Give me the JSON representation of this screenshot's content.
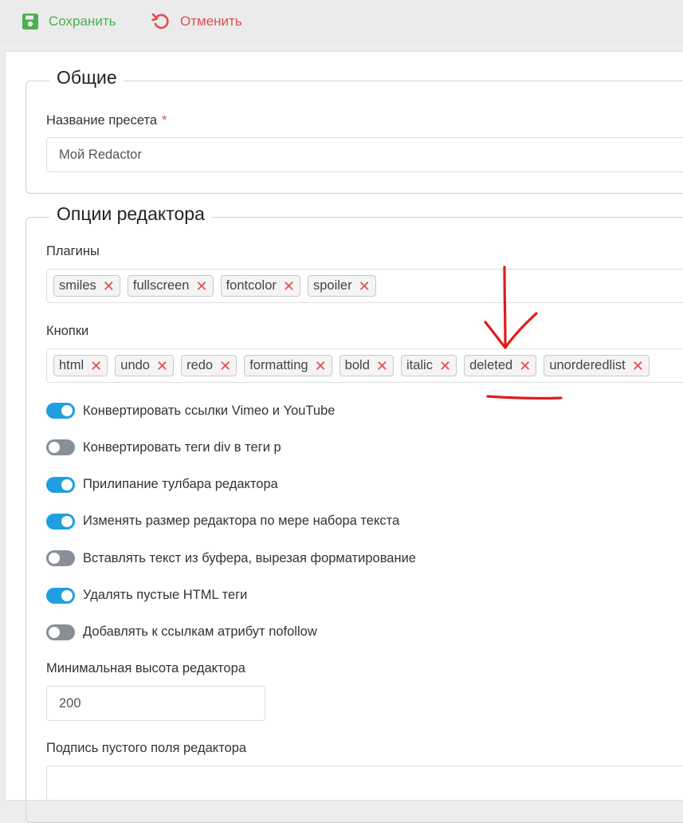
{
  "toolbar": {
    "save_label": "Сохранить",
    "cancel_label": "Отменить",
    "save_icon": "floppy-disk-icon",
    "cancel_icon": "undo-arrow-icon",
    "save_color": "#4caf50",
    "cancel_color": "#e34d4d"
  },
  "general": {
    "legend": "Общие",
    "preset_label": "Название пресета",
    "required_mark": "*",
    "preset_value": "Мой Redactor"
  },
  "editor": {
    "legend": "Опции редактора",
    "plugins_label": "Плагины",
    "plugins": [
      "smiles",
      "fullscreen",
      "fontcolor",
      "spoiler"
    ],
    "buttons_label": "Кнопки",
    "buttons": [
      "html",
      "undo",
      "redo",
      "formatting",
      "bold",
      "italic",
      "deleted",
      "unorderedlist"
    ],
    "remove_glyph": "✕",
    "toggles": [
      {
        "label": "Конвертировать ссылки Vimeo и YouTube",
        "on": true
      },
      {
        "label": "Конвертировать теги div в теги p",
        "on": false
      },
      {
        "label": "Прилипание тулбара редактора",
        "on": true
      },
      {
        "label": "Изменять размер редактора по мере набора текста",
        "on": true
      },
      {
        "label": "Вставлять текст из буфера, вырезая форматирование",
        "on": false
      },
      {
        "label": "Удалять пустые HTML теги",
        "on": true
      },
      {
        "label": "Добавлять к ссылкам атрибут nofollow",
        "on": false
      }
    ],
    "min_height_label": "Минимальная высота редактора",
    "min_height_value": "200",
    "placeholder_label": "Подпись пустого поля редактора",
    "placeholder_value": ""
  },
  "colors": {
    "toggle_on": "#1f9fe0",
    "toggle_off": "#888f96",
    "annotation": "#e01b1b"
  }
}
